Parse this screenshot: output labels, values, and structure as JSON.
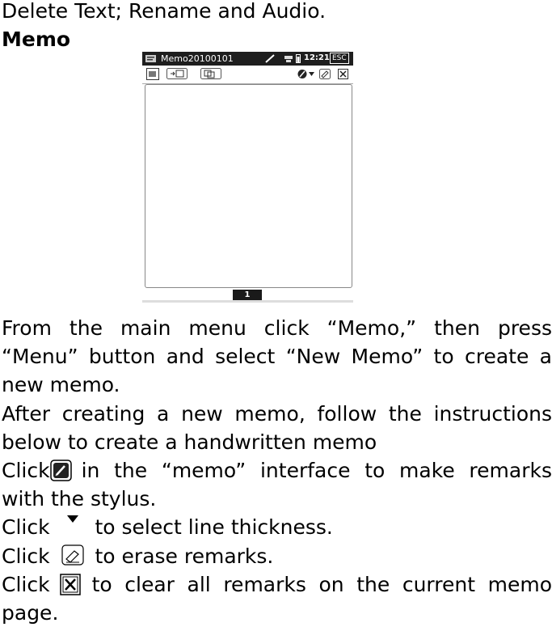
{
  "lines": {
    "l1": "Delete Text; Rename and Audio.",
    "heading": "Memo",
    "p1a": "From the main menu click “Memo,” then press",
    "p1b": "“Menu” button and select “New Memo” to create a",
    "p1c": "new memo.",
    "p2a": "After creating a new memo, follow the instructions",
    "p2b": "below to create a handwritten memo",
    "p3a_pre": "Click",
    "p3a_post": "in the “memo” interface to make remarks",
    "p3b": "with the stylus.",
    "p4_pre": "Click",
    "p4_post": "to select line thickness.",
    "p5_pre": "Click",
    "p5_post": "to erase remarks.",
    "p6_pre": "Click",
    "p6_post": "to clear all remarks on the current memo",
    "p6b": "page."
  },
  "screenshot": {
    "title": "Memo20100101",
    "time": "12:21",
    "esc": "ESC",
    "page_number": "1"
  },
  "icons": {
    "pen": "pen-icon",
    "dropdown": "dropdown-arrow-icon",
    "eraser": "eraser-icon",
    "clear": "clear-page-icon"
  }
}
